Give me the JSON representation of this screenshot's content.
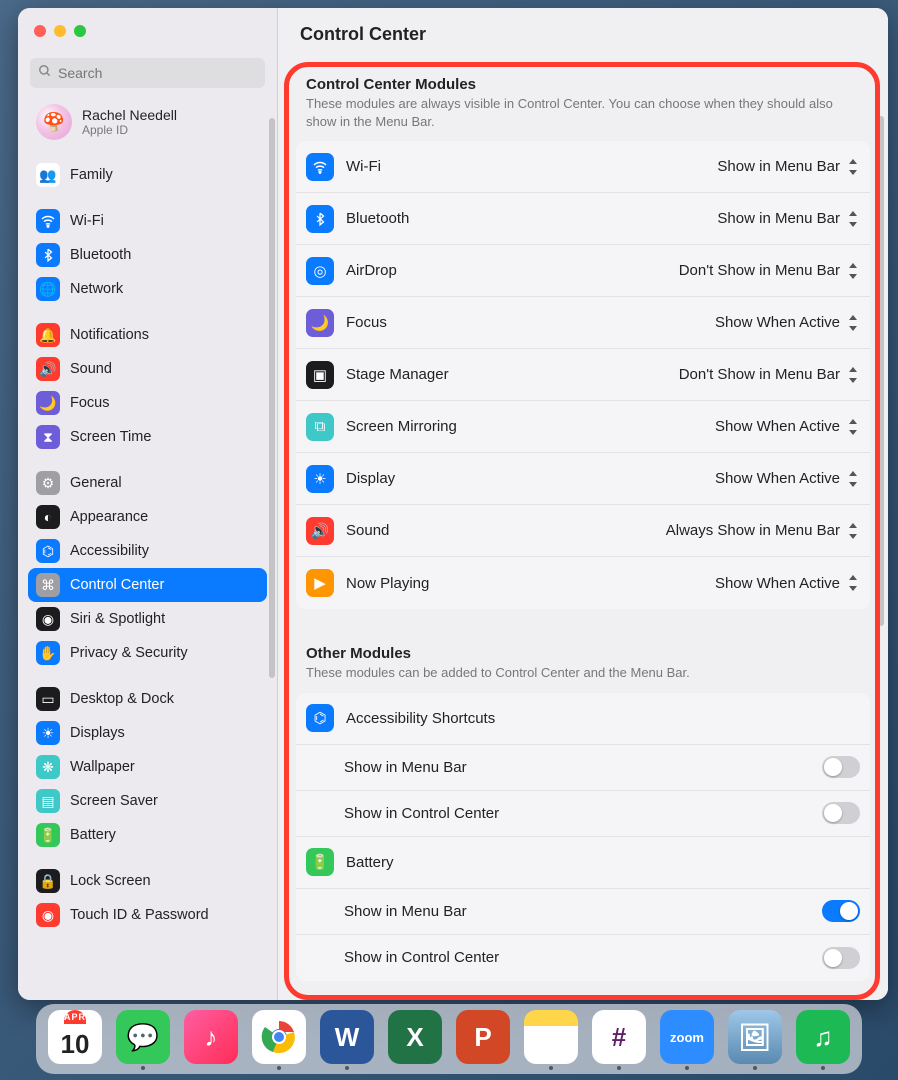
{
  "header": {
    "title": "Control Center"
  },
  "search": {
    "placeholder": "Search"
  },
  "user": {
    "name": "Rachel Needell",
    "sub": "Apple ID"
  },
  "sidebar": {
    "groups": [
      [
        {
          "label": "Family",
          "icon": "👥",
          "bg": "#ffffff",
          "fg": "#4aa0ff"
        }
      ],
      [
        {
          "label": "Wi-Fi",
          "icon": "wifi",
          "bg": "#0a7aff"
        },
        {
          "label": "Bluetooth",
          "icon": "bt",
          "bg": "#0a7aff"
        },
        {
          "label": "Network",
          "icon": "🌐",
          "bg": "#0a7aff"
        }
      ],
      [
        {
          "label": "Notifications",
          "icon": "🔔",
          "bg": "#ff3b30"
        },
        {
          "label": "Sound",
          "icon": "🔊",
          "bg": "#ff3b30"
        },
        {
          "label": "Focus",
          "icon": "🌙",
          "bg": "#6e5dd8"
        },
        {
          "label": "Screen Time",
          "icon": "⧗",
          "bg": "#6e5dd8"
        }
      ],
      [
        {
          "label": "General",
          "icon": "⚙",
          "bg": "#9e9ea3"
        },
        {
          "label": "Appearance",
          "icon": "◐",
          "bg": "#1c1c1e"
        },
        {
          "label": "Accessibility",
          "icon": "⌬",
          "bg": "#0a7aff"
        },
        {
          "label": "Control Center",
          "icon": "⌘",
          "bg": "#9e9ea3",
          "selected": true
        },
        {
          "label": "Siri & Spotlight",
          "icon": "◉",
          "bg": "#1c1c1e"
        },
        {
          "label": "Privacy & Security",
          "icon": "✋",
          "bg": "#0a7aff"
        }
      ],
      [
        {
          "label": "Desktop & Dock",
          "icon": "▭",
          "bg": "#1c1c1e"
        },
        {
          "label": "Displays",
          "icon": "☀",
          "bg": "#0a7aff"
        },
        {
          "label": "Wallpaper",
          "icon": "❋",
          "bg": "#3ec8c8"
        },
        {
          "label": "Screen Saver",
          "icon": "▤",
          "bg": "#3ec8c8"
        },
        {
          "label": "Battery",
          "icon": "🔋",
          "bg": "#34c759"
        }
      ],
      [
        {
          "label": "Lock Screen",
          "icon": "🔒",
          "bg": "#1c1c1e"
        },
        {
          "label": "Touch ID & Password",
          "icon": "◉",
          "bg": "#ff3b30"
        }
      ]
    ]
  },
  "sections": [
    {
      "title": "Control Center Modules",
      "desc": "These modules are always visible in Control Center. You can choose when they should also show in the Menu Bar.",
      "modules": [
        {
          "label": "Wi-Fi",
          "icon": "wifi",
          "bg": "#0a7aff",
          "value": "Show in Menu Bar"
        },
        {
          "label": "Bluetooth",
          "icon": "bt",
          "bg": "#0a7aff",
          "value": "Show in Menu Bar"
        },
        {
          "label": "AirDrop",
          "icon": "◎",
          "bg": "#0a7aff",
          "value": "Don't Show in Menu Bar"
        },
        {
          "label": "Focus",
          "icon": "🌙",
          "bg": "#6e5dd8",
          "value": "Show When Active"
        },
        {
          "label": "Stage Manager",
          "icon": "▣",
          "bg": "#1c1c1e",
          "value": "Don't Show in Menu Bar"
        },
        {
          "label": "Screen Mirroring",
          "icon": "⧉",
          "bg": "#3ec8c8",
          "value": "Show When Active"
        },
        {
          "label": "Display",
          "icon": "☀",
          "bg": "#0a7aff",
          "value": "Show When Active"
        },
        {
          "label": "Sound",
          "icon": "🔊",
          "bg": "#ff3b30",
          "value": "Always Show in Menu Bar"
        },
        {
          "label": "Now Playing",
          "icon": "▶",
          "bg": "#ff9500",
          "value": "Show When Active"
        }
      ]
    },
    {
      "title": "Other Modules",
      "desc": "These modules can be added to Control Center and the Menu Bar.",
      "other": [
        {
          "label": "Accessibility Shortcuts",
          "icon": "⌬",
          "bg": "#0a7aff",
          "toggles": [
            {
              "label": "Show in Menu Bar",
              "on": false
            },
            {
              "label": "Show in Control Center",
              "on": false
            }
          ]
        },
        {
          "label": "Battery",
          "icon": "🔋",
          "bg": "#34c759",
          "toggles": [
            {
              "label": "Show in Menu Bar",
              "on": true
            },
            {
              "label": "Show in Control Center",
              "on": false
            }
          ]
        }
      ]
    }
  ],
  "dock": {
    "cal": {
      "month": "APR",
      "day": "10"
    },
    "items": [
      {
        "name": "calendar",
        "bg": "#ffffff",
        "letter": "",
        "dot": false
      },
      {
        "name": "messages",
        "bg": "#34c759",
        "letter": "💬",
        "dot": true
      },
      {
        "name": "music",
        "bg": "linear-gradient(135deg,#ff5ea3,#ff2d55)",
        "letter": "♪",
        "dot": false
      },
      {
        "name": "chrome",
        "bg": "#ffffff",
        "letter": "◯",
        "dot": true
      },
      {
        "name": "word",
        "bg": "#2b579a",
        "letter": "W",
        "dot": true
      },
      {
        "name": "excel",
        "bg": "#217346",
        "letter": "X",
        "dot": false
      },
      {
        "name": "powerpoint",
        "bg": "#d24726",
        "letter": "P",
        "dot": false
      },
      {
        "name": "notes",
        "bg": "linear-gradient(180deg,#ffd54a 30%,#fff 30%)",
        "letter": "",
        "dot": true
      },
      {
        "name": "slack",
        "bg": "#ffffff",
        "letter": "✱",
        "dot": true
      },
      {
        "name": "zoom",
        "bg": "#2d8cff",
        "letter": "zoom",
        "dot": true,
        "fs": "13px"
      },
      {
        "name": "preview",
        "bg": "linear-gradient(180deg,#9ec7e8,#5a8ab0)",
        "letter": "🖼",
        "dot": true
      },
      {
        "name": "spotify",
        "bg": "#1db954",
        "letter": "♫",
        "dot": true
      }
    ]
  }
}
